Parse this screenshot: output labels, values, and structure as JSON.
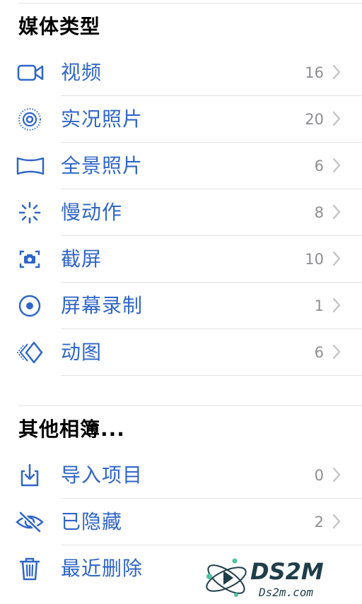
{
  "media_types": {
    "title": "媒体类型",
    "items": [
      {
        "label": "视频",
        "count": "16",
        "icon": "video-icon"
      },
      {
        "label": "实况照片",
        "count": "20",
        "icon": "live-photo-icon"
      },
      {
        "label": "全景照片",
        "count": "6",
        "icon": "panorama-icon"
      },
      {
        "label": "慢动作",
        "count": "8",
        "icon": "slow-motion-icon"
      },
      {
        "label": "截屏",
        "count": "10",
        "icon": "screenshot-icon"
      },
      {
        "label": "屏幕录制",
        "count": "1",
        "icon": "screen-recording-icon"
      },
      {
        "label": "动图",
        "count": "6",
        "icon": "animated-icon"
      }
    ]
  },
  "other_albums": {
    "title": "其他相簿...",
    "items": [
      {
        "label": "导入项目",
        "count": "0",
        "icon": "import-icon"
      },
      {
        "label": "已隐藏",
        "count": "2",
        "icon": "hidden-eye-icon"
      },
      {
        "label": "最近删除",
        "count": "",
        "icon": "trash-icon"
      }
    ]
  },
  "watermark": {
    "brand": "DS2M",
    "domain": "Ds2m.com"
  },
  "colors": {
    "accent": "#2f66c7",
    "count": "#8e8e93",
    "separator": "#e3e3e6",
    "chevron": "#c4c4c7"
  }
}
